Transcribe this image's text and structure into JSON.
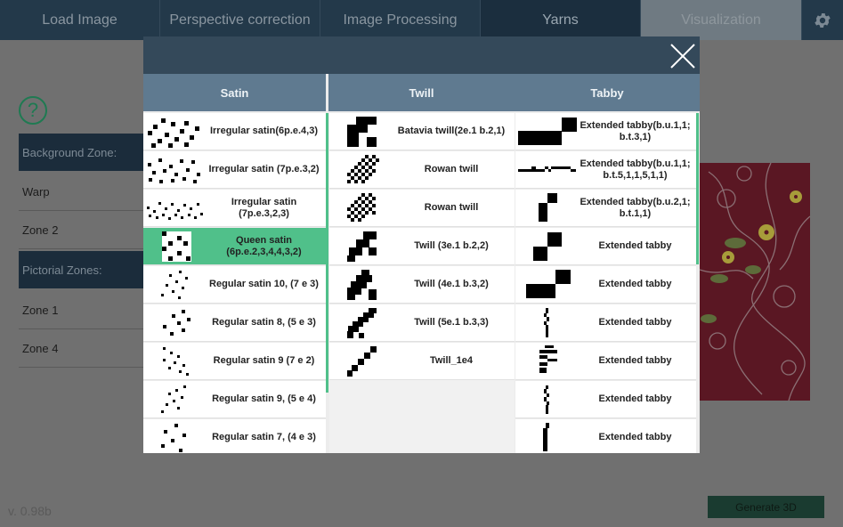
{
  "nav": {
    "tabs": [
      "Load Image",
      "Perspective correction",
      "Image Processing",
      "Yarns",
      "Visualization"
    ]
  },
  "sidebar": {
    "help": "?",
    "background_zone": "Background Zone:",
    "warp": "Warp",
    "zone2": "Zone 2",
    "pictorial_zones": "Pictorial Zones:",
    "zone1": "Zone 1",
    "zone4": "Zone 4"
  },
  "version": "v. 0.98b",
  "generate_button": "Generate 3D",
  "dialog": {
    "columns": [
      "Satin",
      "Twill",
      "Tabby"
    ],
    "satin": [
      "Irregular satin(6p.e.4,3)",
      "Irregular satin (7p.e.3,2)",
      "Irregular satin (7p.e.3,2,3)",
      "Queen satin (6p.e.2,3,4,4,3,2)",
      "Regular satin 10, (7 e 3)",
      "Regular satin 8, (5 e 3)",
      "Regular satin 9 (7 e 2)",
      "Regular satin 9, (5 e 4)",
      "Regular satin 7, (4 e 3)"
    ],
    "selected_satin": 3,
    "twill": [
      "Batavia twill(2e.1 b.2,1)",
      "Rowan twill",
      "Rowan twill",
      "Twill (3e.1 b.2,2)",
      "Twill (4e.1 b.3,2)",
      "Twill (5e.1 b.3,3)",
      "Twill_1e4"
    ],
    "tabby": [
      "Extended tabby(b.u.1,1; b.t.3,1)",
      "Extended tabby(b.u.1,1; b.t.5,1,1,5,1,1)",
      "Extended tabby(b.u.2,1; b.t.1,1)",
      "Extended tabby",
      "Extended tabby",
      "Extended tabby",
      "Extended tabby",
      "Extended tabby",
      "Extended tabby"
    ],
    "accent": "#50c08a"
  }
}
